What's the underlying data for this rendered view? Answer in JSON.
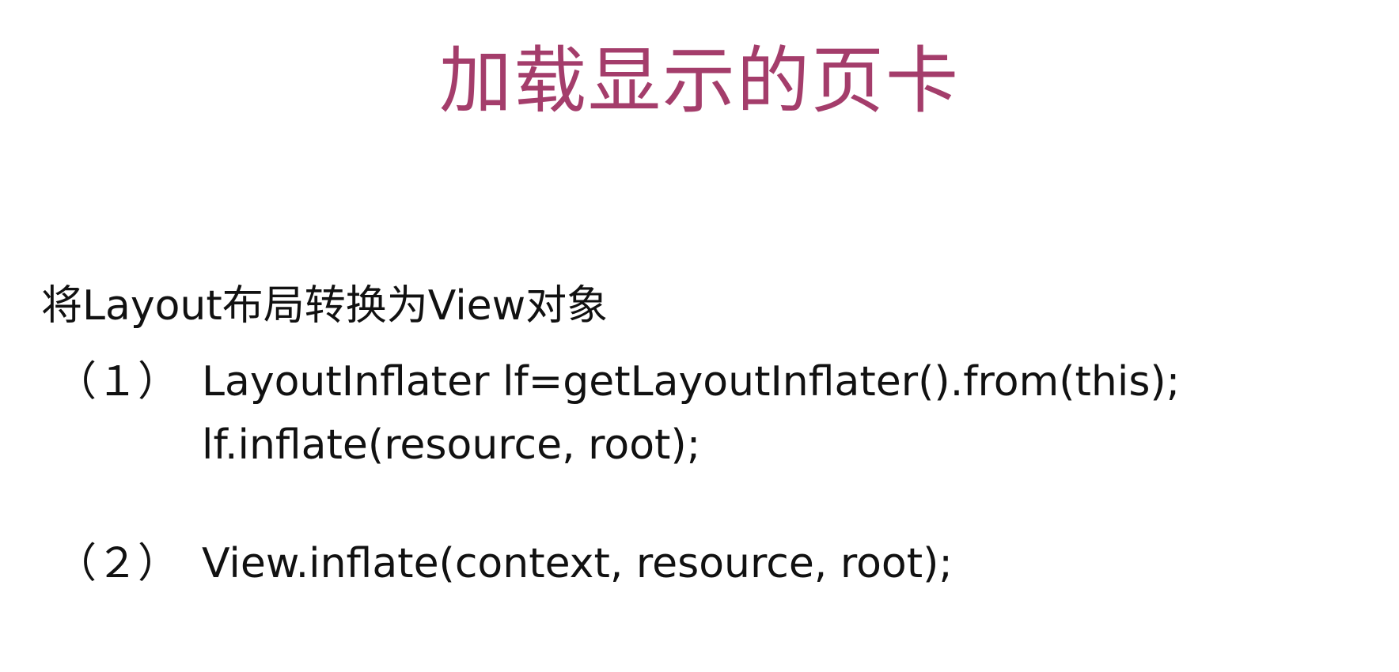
{
  "slide": {
    "title": "加载显示的页卡",
    "title_color": "#a43d6b",
    "text_color": "#111111",
    "subtitle": "将Layout布局转换为View对象",
    "items": [
      {
        "marker": "（１）",
        "lines": [
          "LayoutInflater lf=getLayoutInflater().from(this);",
          "lf.inflate(resource, root);"
        ]
      },
      {
        "marker": "（２）",
        "lines": [
          "View.inflate(context, resource, root);"
        ]
      }
    ]
  }
}
